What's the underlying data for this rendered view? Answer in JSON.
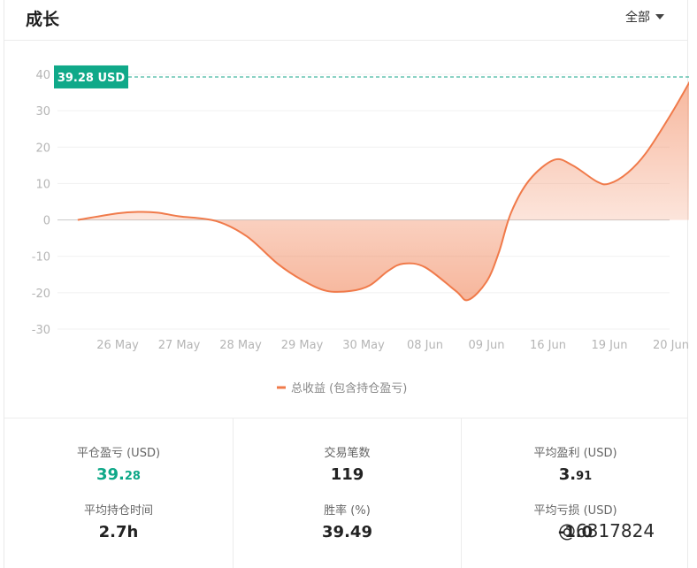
{
  "header": {
    "title": "成长",
    "range_label": "全部"
  },
  "chart_data": {
    "type": "area",
    "categories": [
      "26 May",
      "27 May",
      "28 May",
      "29 May",
      "30 May",
      "08 Jun",
      "09 Jun",
      "16 Jun",
      "19 Jun",
      "20 Jun"
    ],
    "y_ticks": [
      "40",
      "30",
      "20",
      "10",
      "0",
      "-10",
      "-20",
      "-30"
    ],
    "ylim": [
      -30,
      40
    ],
    "series": [
      {
        "name": "总收益 (包含持仓盈亏)",
        "color": "#f07a4a",
        "points": [
          [
            -0.65,
            0
          ],
          [
            0,
            1.8
          ],
          [
            0.35,
            2.2
          ],
          [
            0.65,
            2
          ],
          [
            1,
            1
          ],
          [
            1.6,
            -0.3
          ],
          [
            2.1,
            -4.5
          ],
          [
            2.6,
            -12
          ],
          [
            3,
            -16.5
          ],
          [
            3.4,
            -19.5
          ],
          [
            3.8,
            -19.5
          ],
          [
            4.1,
            -18
          ],
          [
            4.4,
            -14
          ],
          [
            4.65,
            -12
          ],
          [
            5,
            -13
          ],
          [
            5.5,
            -19.5
          ],
          [
            5.7,
            -22
          ],
          [
            6,
            -17
          ],
          [
            6.2,
            -9
          ],
          [
            6.4,
            2
          ],
          [
            6.7,
            11
          ],
          [
            7.1,
            16.5
          ],
          [
            7.4,
            15
          ],
          [
            7.8,
            10.5
          ],
          [
            8,
            10
          ],
          [
            8.3,
            13
          ],
          [
            8.6,
            18.5
          ],
          [
            9.0,
            29
          ],
          [
            9.35,
            39.28
          ]
        ]
      }
    ],
    "current_value_label": "39.28 USD",
    "current_value": 39.28,
    "legend": "bottom-center",
    "grid": true
  },
  "stats": {
    "closed_pnl": {
      "label": "平仓盈亏 (USD)",
      "int": "39.",
      "dec": "28"
    },
    "avg_hold": {
      "label": "平均持仓时间",
      "value": "2.7h"
    },
    "trade_count": {
      "label": "交易笔数",
      "value": "119"
    },
    "win_rate": {
      "label": "胜率 (%)",
      "value": "39.49"
    },
    "avg_profit": {
      "label": "平均盈利 (USD)",
      "int": "3.",
      "dec": "91"
    },
    "avg_loss": {
      "label": "平均亏损 (USD)",
      "value": "-1.0"
    }
  },
  "watermark": "@6317824"
}
